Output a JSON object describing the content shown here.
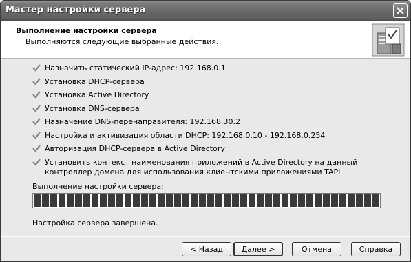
{
  "window": {
    "title": "Мастер настройки сервера"
  },
  "header": {
    "title": "Выполнение настройки сервера",
    "subtitle": "Выполняются следующие выбранные действия."
  },
  "tasks": [
    {
      "label": "Назначить статический IP-адрес: 192.168.0.1",
      "status": "done"
    },
    {
      "label": "Установка DHCP-сервера",
      "status": "done"
    },
    {
      "label": "Установка Active Directory",
      "status": "done"
    },
    {
      "label": "Установка DNS-сервера",
      "status": "done"
    },
    {
      "label": "Назначение DNS-перенаправителя: 192.168.30.2",
      "status": "done"
    },
    {
      "label": "Настройка и активизация области DHCP: 192.168.0.10 - 192.168.0.254",
      "status": "done"
    },
    {
      "label": "Авторизация DHCP-сервера в Active Directory",
      "status": "done"
    },
    {
      "label": "Установить контекст наименования приложений в Active Directory на данный",
      "label2": "контроллер домена для использования клиентскими приложениями TAPI",
      "status": "done"
    }
  ],
  "progress": {
    "label": "Выполнение настройки сервера:",
    "percent": 100
  },
  "status_text": "Настройка сервера завершена.",
  "buttons": {
    "back": "< Назад",
    "next": "Далее >",
    "cancel": "Отмена",
    "help": "Справка"
  },
  "icons": {
    "close": "close-icon",
    "wizard": "server-wizard-icon",
    "check": "check-icon"
  }
}
